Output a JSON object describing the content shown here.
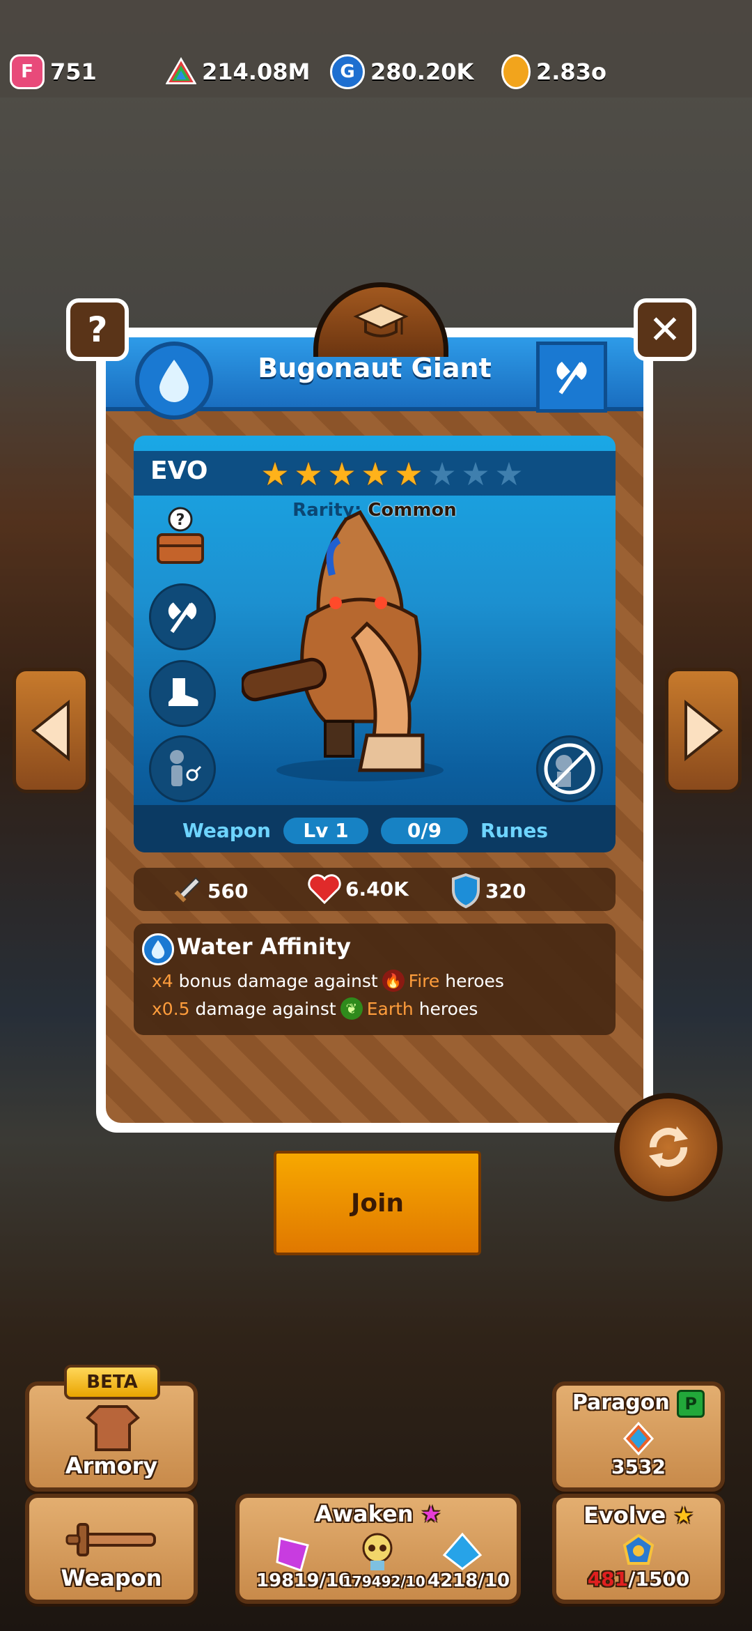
{
  "currencies": [
    {
      "icon": "f-gem-icon",
      "value": "751"
    },
    {
      "icon": "tri-gem-icon",
      "value": "214.08M"
    },
    {
      "icon": "g-coin-icon",
      "value": "280.20K"
    },
    {
      "icon": "gold-coin-icon",
      "value": "2.83o"
    }
  ],
  "hero": {
    "name": "Bugonaut Giant",
    "element": "Water",
    "evo_label": "EVO",
    "stars_total": 8,
    "stars_filled": 5,
    "rarity_label": "Rarity:",
    "rarity_value": "Common"
  },
  "weapon_bar": {
    "weapon_label": "Weapon",
    "level": "Lv 1",
    "runes_count": "0/9",
    "runes_label": "Runes"
  },
  "stats": {
    "attack": "560",
    "health": "6.40K",
    "defense": "320"
  },
  "affinity": {
    "title": "Water Affinity",
    "line1": {
      "mult": "x4",
      "text": "bonus damage against",
      "element": "Fire",
      "suffix": "heroes"
    },
    "line2": {
      "mult": "x0.5",
      "text": "damage against",
      "element": "Earth",
      "suffix": "heroes"
    }
  },
  "buttons": {
    "join": "Join"
  },
  "bottom_menu": {
    "armory": {
      "badge": "BETA",
      "label": "Armory"
    },
    "weapon": {
      "label": "Weapon"
    },
    "paragon": {
      "label": "Paragon",
      "badge": "P",
      "value": "3532"
    },
    "awaken": {
      "label": "Awaken",
      "items": [
        "19819/10",
        "179492/10",
        "4218/10"
      ]
    },
    "evolve": {
      "label": "Evolve",
      "current": "481",
      "total": "/1500"
    }
  },
  "colors": {
    "title_blue": "#1a79d2",
    "join_orange": "#f7a800",
    "tile_tan": "#d69a58",
    "evolve_red": "#e02020"
  }
}
